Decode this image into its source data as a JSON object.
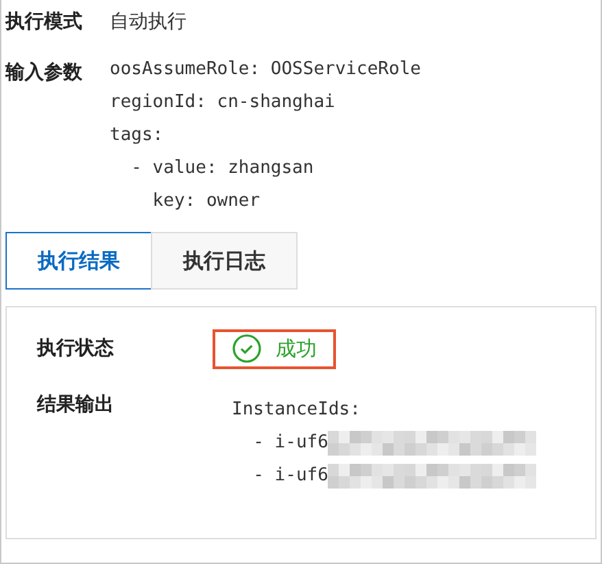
{
  "details": [
    {
      "label": "执行模式",
      "kind": "text",
      "value": "自动执行"
    },
    {
      "label": "输入参数",
      "kind": "code",
      "lines": [
        "oosAssumeRole: OOSServiceRole",
        "regionId: cn-shanghai",
        "tags:",
        "  - value: zhangsan",
        "    key: owner"
      ]
    }
  ],
  "tabs": [
    {
      "label": "执行结果",
      "selected": true
    },
    {
      "label": "执行日志",
      "selected": false
    }
  ],
  "result": {
    "status_label": "执行状态",
    "status": {
      "text": "成功",
      "kind": "success",
      "highlighted": true
    },
    "output_label": "结果输出",
    "output_lines": [
      {
        "text": "InstanceIds:",
        "redacted": false
      },
      {
        "text": "  - i-uf6",
        "redacted": true
      },
      {
        "text": "  - i-uf6",
        "redacted": true
      }
    ]
  }
}
